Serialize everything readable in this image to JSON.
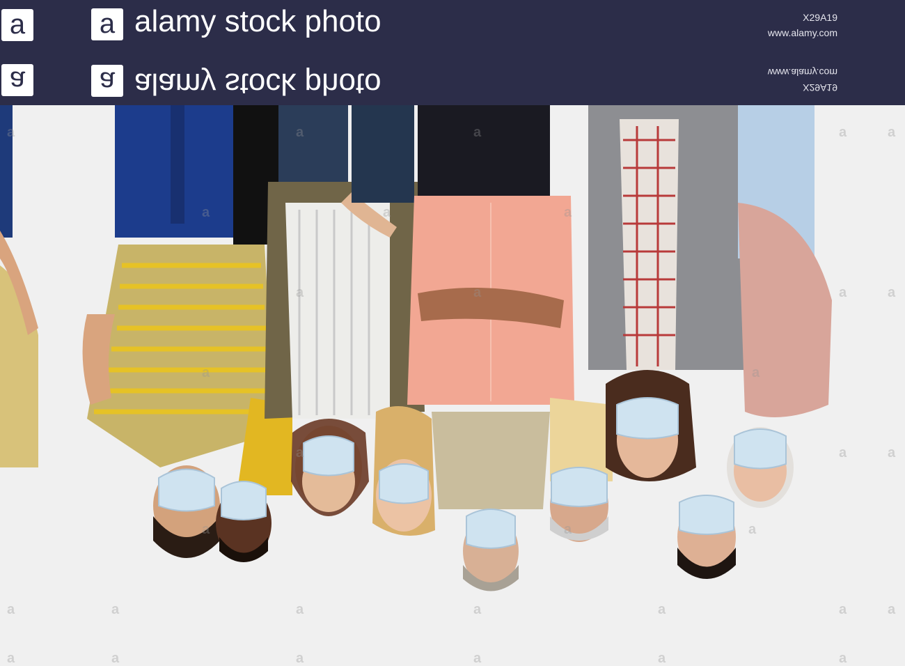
{
  "banner": {
    "logo_letter": "a",
    "brand": "alamy stock photo",
    "image_id": "X29A19",
    "website": "www.alamy.com",
    "background": "#2c2d49"
  },
  "photo": {
    "watermark_glyph": "a",
    "people_count": 12
  }
}
